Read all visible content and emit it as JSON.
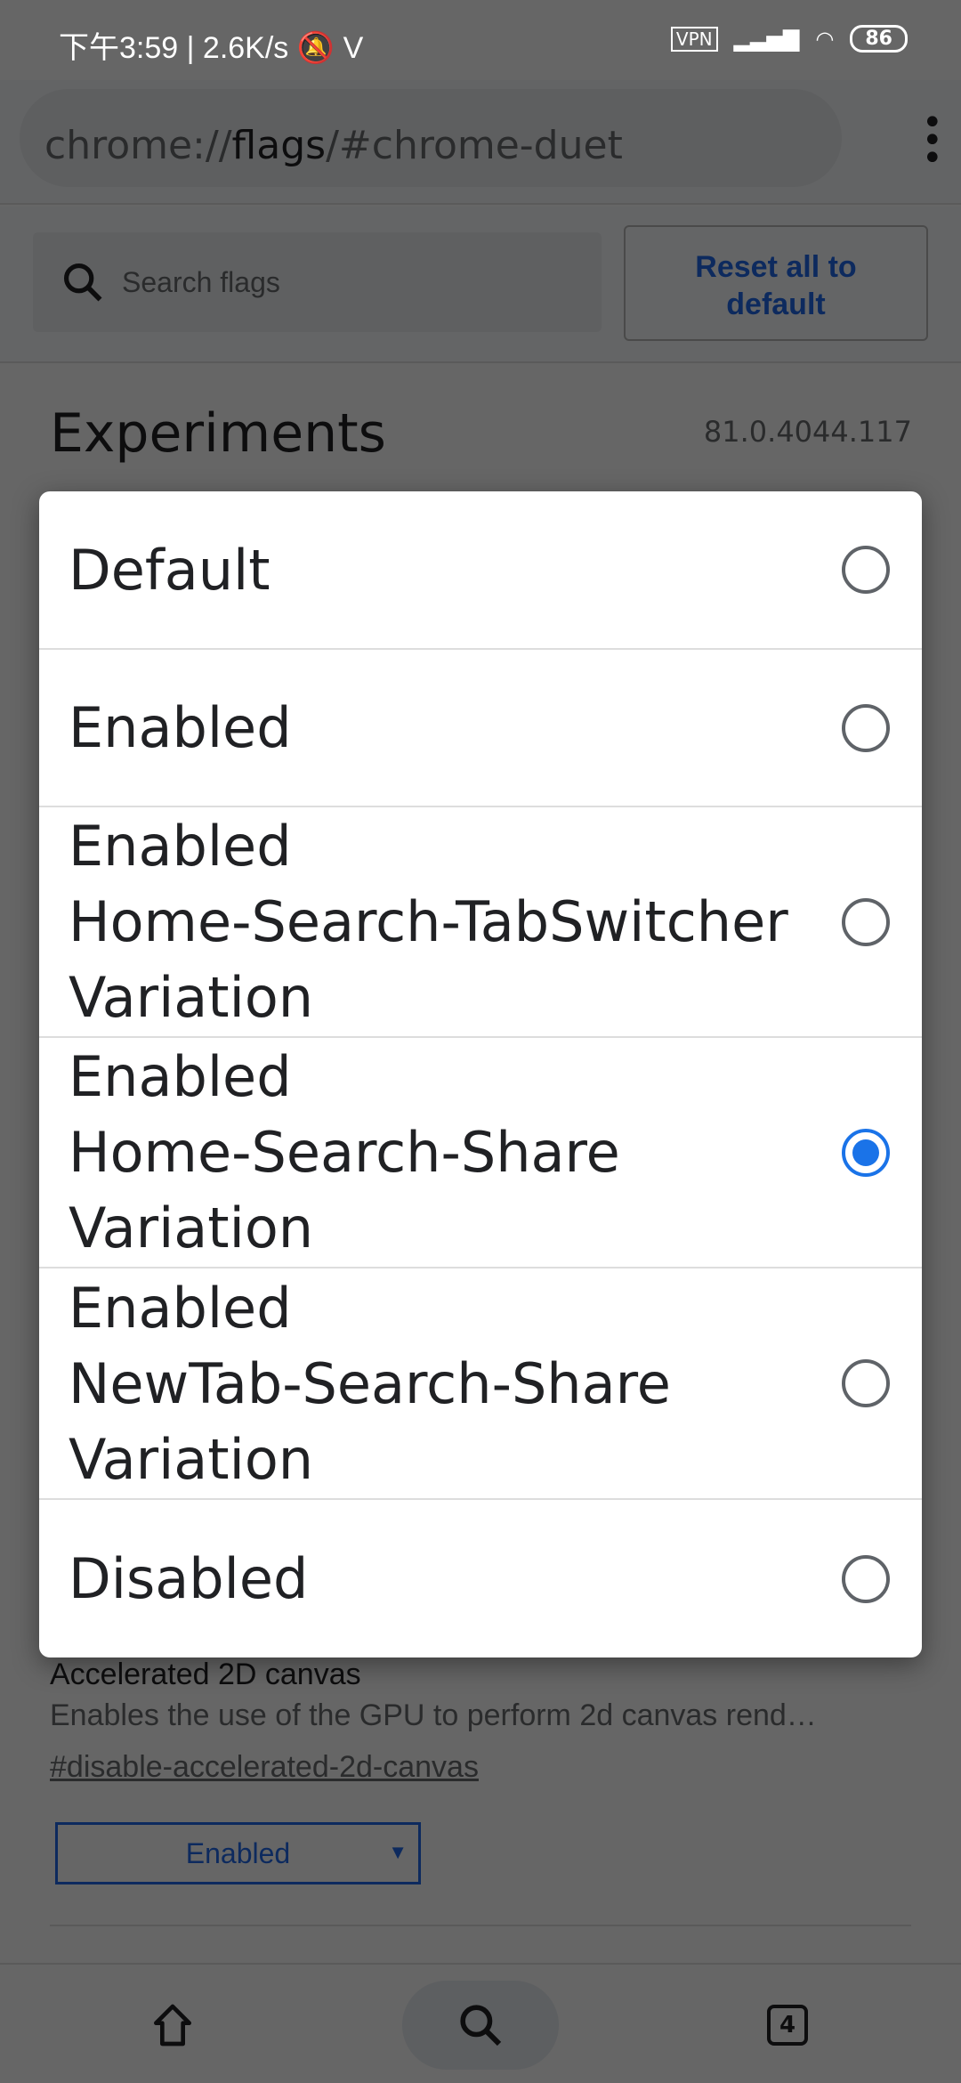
{
  "status_bar": {
    "time": "下午3:59",
    "speed": "2.6K/s",
    "vpn": "VPN",
    "battery": "86"
  },
  "toolbar": {
    "url_prefix": "chrome://",
    "url_host": "flags",
    "url_suffix": "/#chrome-duet",
    "menu_icon": "more-vert-icon"
  },
  "header": {
    "search_placeholder": "Search flags",
    "reset_label_1": "Reset all to",
    "reset_label_2": "default"
  },
  "page": {
    "title": "Experiments",
    "version": "81.0.4044.117",
    "flag": {
      "title": "Accelerated 2D canvas",
      "description": "Enables the use of the GPU to perform 2d canvas rend…",
      "link": "#disable-accelerated-2d-canvas",
      "selected": "Enabled"
    }
  },
  "dialog": {
    "options": [
      {
        "lines": [
          "Default"
        ],
        "selected": false
      },
      {
        "lines": [
          "Enabled"
        ],
        "selected": false
      },
      {
        "lines": [
          "Enabled",
          "Home-Search-TabSwitcher",
          "Variation"
        ],
        "selected": false
      },
      {
        "lines": [
          "Enabled",
          "Home-Search-Share",
          "Variation"
        ],
        "selected": true
      },
      {
        "lines": [
          "Enabled",
          "NewTab-Search-Share",
          "Variation"
        ],
        "selected": false
      },
      {
        "lines": [
          "Disabled"
        ],
        "selected": false
      }
    ],
    "accent": "#1a73e8"
  },
  "bottom_nav": {
    "tab_count": "4"
  }
}
